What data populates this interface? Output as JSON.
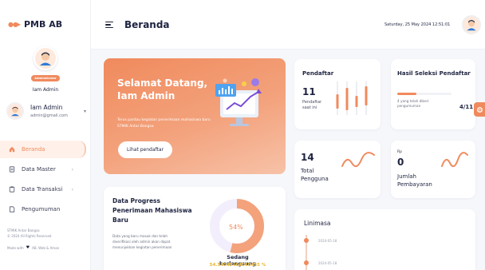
{
  "brand": {
    "name": "PMB AB"
  },
  "sidebar": {
    "role_badge": "Administrator",
    "top_username": "Iam Admin",
    "user": {
      "name": "Iam Admin",
      "email": "admin@gmail.com"
    },
    "items": [
      {
        "label": "Beranda",
        "icon": "home-icon",
        "active": true
      },
      {
        "label": "Data Master",
        "icon": "document-icon",
        "has_arrow": true
      },
      {
        "label": "Data Transaksi",
        "icon": "clipboard-icon",
        "has_arrow": true
      },
      {
        "label": "Pengumuman",
        "icon": "file-icon"
      }
    ],
    "footer": {
      "line1": "STMIK Antar Bangsa",
      "line2": "© 2024 All Rights Reserved",
      "made_prefix": "Made with",
      "made_suffix": "AB. Web & Aman"
    }
  },
  "header": {
    "title": "Beranda",
    "datetime": "Saturday, 25 May 2024 12:51:01"
  },
  "welcome": {
    "title_line1": "Selamat Datang,",
    "title_line2": "Iam Admin",
    "subtitle": "Terus pantau kegiatan penerimaan mahasiswa baru STMIK Antar Bangsa",
    "button": "Lihat pendaftar"
  },
  "pendaftar": {
    "title": "Pendaftar",
    "value": "11",
    "label": "Pendaftar saat ini"
  },
  "hasil": {
    "title": "Hasil Seleksi Pendaftar",
    "note": "4 yang telah diberi pengumuman",
    "count": "4/11",
    "progress": 0.36
  },
  "pengguna": {
    "value": "14",
    "label_line1": "Total",
    "label_line2": "Pengguna"
  },
  "pembayaran": {
    "currency": "Rp",
    "value": "0",
    "label_line1": "Jumlah",
    "label_line2": "Pembayaran"
  },
  "progress": {
    "title_line1": "Data Progress",
    "title_line2": "Penerimaan Mahasiswa",
    "title_line3": "Baru",
    "desc": "Data yang baru masuk dan telah diverifikasi oleh admin akan dapat menunjukkan kegiatan penerimaan",
    "percent_label": "54%",
    "percent": 54,
    "status": "Sedang berlangsung",
    "status_value": "54.54545454545455 %"
  },
  "limimasa": {
    "title": "Linimasa",
    "items": [
      {
        "date": "2024-05-18"
      },
      {
        "date": "2024-05-18"
      }
    ]
  },
  "colors": {
    "accent": "#f08a5d",
    "dark": "#1e2340"
  }
}
